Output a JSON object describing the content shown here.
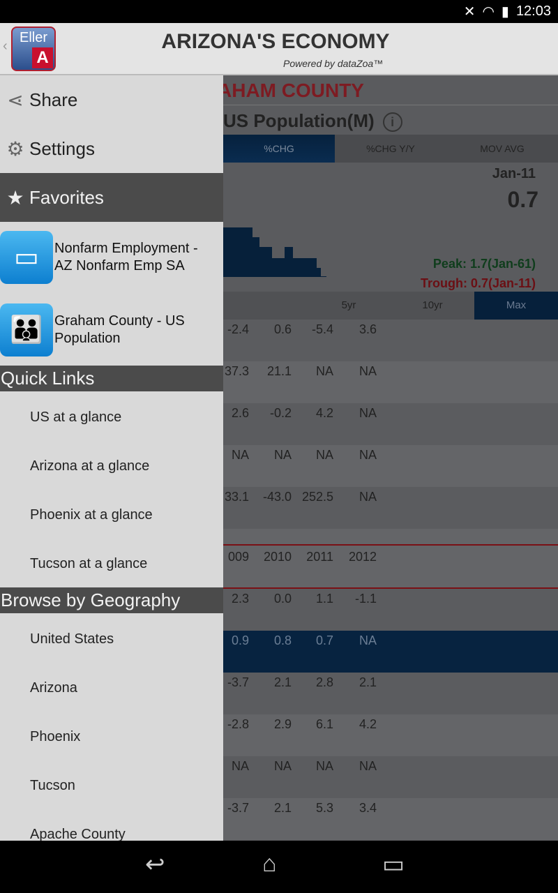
{
  "status": {
    "time": "12:03"
  },
  "header": {
    "title": "ARIZONA'S ECONOMY",
    "powered": "Powered by dataZoa™",
    "logo_text": "Eller",
    "logo_letter": "A"
  },
  "main": {
    "county": "AHAM COUNTY",
    "series": "US Population(M)",
    "tabs": [
      {
        "label": "%CHG",
        "selected": true
      },
      {
        "label": "%CHG Y/Y"
      },
      {
        "label": "MOV AVG"
      }
    ],
    "date": "Jan-11",
    "value": "0.7",
    "peak": "Peak: 1.7(Jan-61)",
    "trough": "Trough: 0.7(Jan-11)",
    "ranges": [
      {
        "label": "5yr"
      },
      {
        "label": "10yr"
      },
      {
        "label": "Max",
        "selected": true
      }
    ],
    "rows_top": [
      [
        "-2.4",
        "0.6",
        "-5.4",
        "3.6"
      ],
      [
        "37.3",
        "21.1",
        "NA",
        "NA"
      ],
      [
        "2.6",
        "-0.2",
        "4.2",
        "NA"
      ],
      [
        "NA",
        "NA",
        "NA",
        "NA"
      ],
      [
        "33.1",
        "-43.0",
        "252.5",
        "NA"
      ]
    ],
    "years": [
      "009",
      "2010",
      "2011",
      "2012"
    ],
    "rows_bottom": [
      [
        "2.3",
        "0.0",
        "1.1",
        "-1.1"
      ],
      [
        "0.9",
        "0.8",
        "0.7",
        "NA"
      ],
      [
        "-3.7",
        "2.1",
        "2.8",
        "2.1"
      ],
      [
        "-2.8",
        "2.9",
        "6.1",
        "4.2"
      ],
      [
        "NA",
        "NA",
        "NA",
        "NA"
      ],
      [
        "-3.7",
        "2.1",
        "5.3",
        "3.4"
      ]
    ]
  },
  "drawer": {
    "share": "Share",
    "settings": "Settings",
    "favorites": "Favorites",
    "fav_items": [
      {
        "line1": "Nonfarm Employment -",
        "line2": "AZ Nonfarm Emp SA",
        "icon": "briefcase-icon"
      },
      {
        "line1": "Graham County - US",
        "line2": "Population",
        "icon": "people-icon"
      }
    ],
    "quick_links_header": "Quick Links",
    "quick_links": [
      "US at a glance",
      "Arizona at a glance",
      "Phoenix at a glance",
      "Tucson at a glance"
    ],
    "geo_header": "Browse by Geography",
    "geo": [
      "United States",
      "Arizona",
      "Phoenix",
      "Tucson",
      "Apache County"
    ]
  },
  "colors": {
    "accent_blue": "#072340",
    "county_red": "#7d1b22",
    "peak_green": "#0f3d1c",
    "trough_red": "#6b0f14"
  }
}
